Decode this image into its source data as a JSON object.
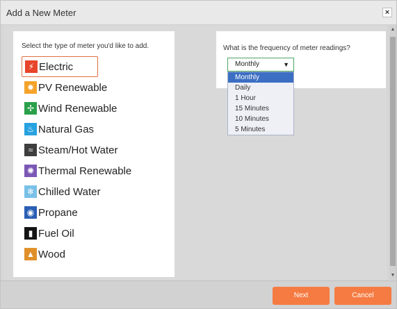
{
  "dialog": {
    "title": "Add a New Meter",
    "close_label": "×"
  },
  "left": {
    "prompt": "Select the type of meter you'd like to add.",
    "meters": [
      {
        "label": "Electric",
        "icon": "electric-icon",
        "color": "#e8452b",
        "selected": true
      },
      {
        "label": "PV Renewable",
        "icon": "pv-renewable-icon",
        "color": "#f4a32a"
      },
      {
        "label": "Wind Renewable",
        "icon": "wind-icon",
        "color": "#2ba04b"
      },
      {
        "label": "Natural Gas",
        "icon": "natural-gas-icon",
        "color": "#27a2e0"
      },
      {
        "label": "Steam/Hot Water",
        "icon": "steam-icon",
        "color": "#3e3e3e"
      },
      {
        "label": "Thermal Renewable",
        "icon": "thermal-icon",
        "color": "#7b58b6"
      },
      {
        "label": "Chilled Water",
        "icon": "chilled-water-icon",
        "color": "#7ac1e8"
      },
      {
        "label": "Propane",
        "icon": "propane-icon",
        "color": "#2b5fb4"
      },
      {
        "label": "Fuel Oil",
        "icon": "fuel-oil-icon",
        "color": "#141414"
      },
      {
        "label": "Wood",
        "icon": "wood-icon",
        "color": "#e0902b"
      }
    ]
  },
  "right": {
    "prompt": "What is the frequency of meter readings?",
    "selected": "Monthly",
    "arrow": "▼",
    "options": [
      "Monthly",
      "Daily",
      "1 Hour",
      "15 Minutes",
      "10 Minutes",
      "5 Minutes"
    ]
  },
  "scrollbar": {
    "up": "▲",
    "down": "▼"
  },
  "footer": {
    "next_label": "Next",
    "cancel_label": "Cancel"
  }
}
